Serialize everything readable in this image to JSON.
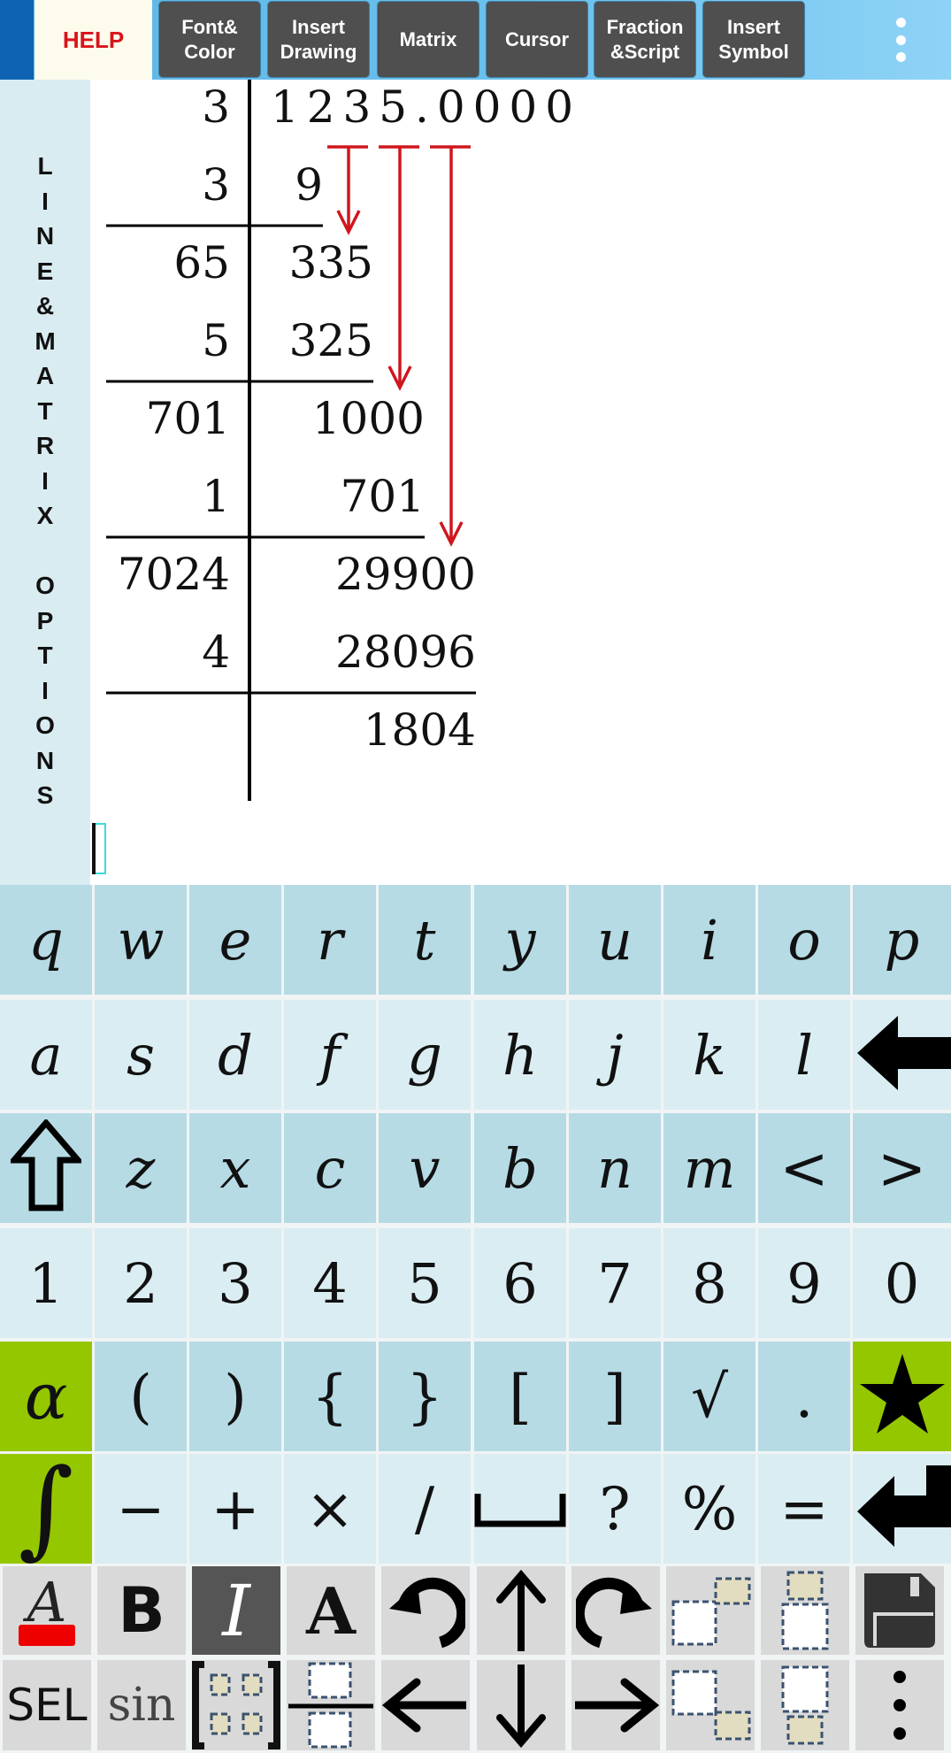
{
  "toolbar": {
    "help_label": "HELP",
    "buttons": [
      {
        "id": "font-color",
        "line1": "Font&",
        "line2": "Color"
      },
      {
        "id": "insert-drawing",
        "line1": "Insert",
        "line2": "Drawing"
      },
      {
        "id": "matrix",
        "line1": "Matrix",
        "line2": ""
      },
      {
        "id": "cursor",
        "line1": "Cursor",
        "line2": ""
      },
      {
        "id": "fraction-script",
        "line1": "Fraction",
        "line2": "&Script"
      },
      {
        "id": "insert-symbol",
        "line1": "Insert",
        "line2": "Symbol"
      }
    ],
    "more_icon": "kebab-vertical-icon"
  },
  "side_panel": {
    "label": "LINE&MATRIX OPTIONS",
    "letters": [
      "L",
      "I",
      "N",
      "E",
      "&",
      "M",
      "A",
      "T",
      "R",
      "I",
      "X",
      " ",
      "O",
      "P",
      "T",
      "I",
      "O",
      "N",
      "S"
    ]
  },
  "math": {
    "description": "Square root of 1235 by long division",
    "left_column": [
      "3",
      "3",
      "65",
      "5",
      "701",
      "1",
      "7024",
      "4",
      ""
    ],
    "right_column": [
      "1235.0000",
      "9",
      "335",
      "325",
      "1000",
      "701",
      "29900",
      "28096",
      "1804"
    ],
    "arrow_color": "#d0161d"
  },
  "keyboard": {
    "rows": [
      {
        "style": "dark",
        "keys": [
          "q",
          "w",
          "e",
          "r",
          "t",
          "y",
          "u",
          "i",
          "o",
          "p"
        ]
      },
      {
        "style": "light",
        "keys": [
          "a",
          "s",
          "d",
          "f",
          "g",
          "h",
          "j",
          "k",
          "l",
          "backspace"
        ]
      },
      {
        "style": "dark",
        "keys": [
          "shift",
          "z",
          "x",
          "c",
          "v",
          "b",
          "n",
          "m",
          "<",
          ">"
        ]
      },
      {
        "style": "light",
        "keys": [
          "1",
          "2",
          "3",
          "4",
          "5",
          "6",
          "7",
          "8",
          "9",
          "0"
        ]
      },
      {
        "style": "dark",
        "keys": [
          "α",
          "(",
          ")",
          "{",
          "}",
          "[",
          "]",
          "√",
          ".",
          "★"
        ]
      },
      {
        "style": "light",
        "keys": [
          "∫",
          "−",
          "+",
          "×",
          "/",
          "␣",
          "?",
          "%",
          "=",
          "enter"
        ]
      }
    ],
    "tool_row1": [
      "text-color",
      "bold",
      "italic",
      "font-style",
      "undo",
      "cursor-up",
      "redo",
      "superscript",
      "overscript",
      "save"
    ],
    "tool_row2": [
      "SEL",
      "sin",
      "matrix",
      "fraction",
      "cursor-left",
      "cursor-down",
      "cursor-right",
      "subscript",
      "underscript",
      "more"
    ],
    "labels": {
      "sel": "SEL",
      "sin": "sin",
      "bold": "B",
      "italic": "I",
      "font": "A",
      "textcolor": "A"
    },
    "colors": {
      "green_key": "#94c700",
      "text_color_swatch": "#ee0000",
      "active_tool": "#555555"
    }
  }
}
